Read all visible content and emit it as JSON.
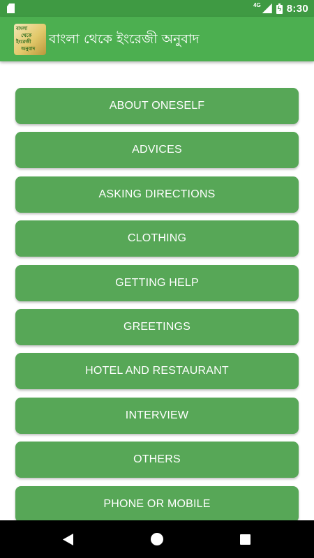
{
  "status_bar": {
    "network_type": "4G",
    "time": "8:30",
    "icons": [
      "sd-card-icon",
      "signal-icon",
      "battery-charging-icon"
    ]
  },
  "app_bar": {
    "title": "বাংলা থেকে ইংরেজী অনুবাদ",
    "logo_text": "বাংলা\n   থেকে\nইংরেজী\n   অনুবাদ",
    "color": "#4caf50"
  },
  "topics": [
    "ABOUT ONESELF",
    "ADVICES",
    "ASKING DIRECTIONS",
    "CLOTHING",
    "GETTING HELP",
    "GREETINGS",
    "HOTEL AND RESTAURANT",
    "INTERVIEW",
    "OTHERS",
    "PHONE OR MOBILE"
  ],
  "colors": {
    "status_bar": "#3f9a43",
    "button": "#57a757",
    "button_text": "#ffffff"
  },
  "nav_bar": {
    "icons": [
      "back-icon",
      "home-icon",
      "recents-icon"
    ]
  }
}
